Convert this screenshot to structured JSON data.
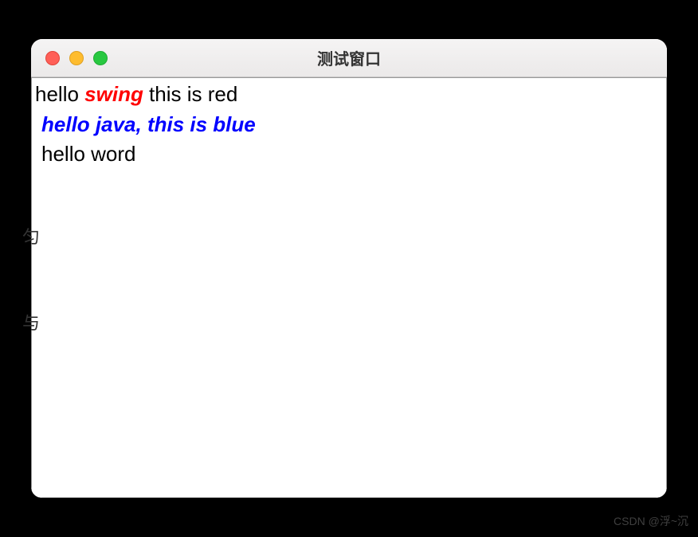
{
  "window": {
    "title": "测试窗口"
  },
  "content": {
    "line1": {
      "part_a": "hello ",
      "part_b": "swing",
      "part_c": " this is red"
    },
    "line2": "hello java, this is blue",
    "line3": "hello word"
  },
  "cropped_left": {
    "top": "匀",
    "bottom": "与"
  },
  "watermark": "CSDN @浮~沉"
}
